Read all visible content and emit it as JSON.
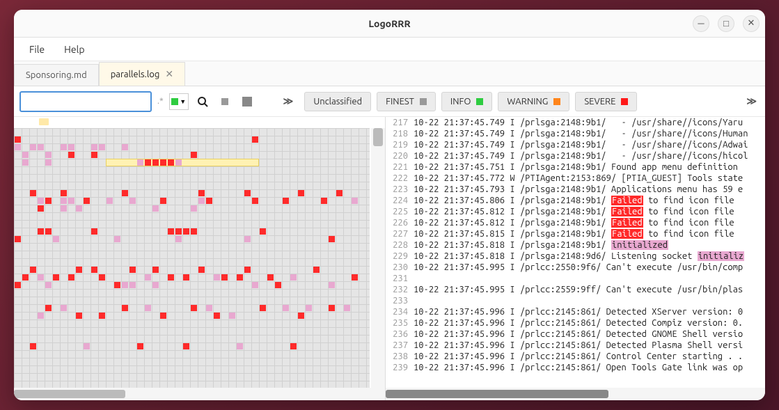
{
  "window": {
    "title": "LogoRRR"
  },
  "menu": {
    "file": "File",
    "help": "Help"
  },
  "tabs": [
    {
      "label": "Sponsoring.md",
      "active": false,
      "closable": false
    },
    {
      "label": "parallels.log",
      "active": true,
      "closable": true
    }
  ],
  "toolbar": {
    "search_value": "",
    "color_swatch": "#2ecc40"
  },
  "filters": [
    {
      "label": "Unclassified",
      "color": null
    },
    {
      "label": "FINEST",
      "color": "gray"
    },
    {
      "label": "INFO",
      "color": "green"
    },
    {
      "label": "WARNING",
      "color": "orange"
    },
    {
      "label": "SEVERE",
      "color": "red"
    }
  ],
  "log": [
    {
      "n": 217,
      "t": "10-22 21:37:45.749 I /prlsga:2148:9b1/   - /usr/share//icons/Yaru"
    },
    {
      "n": 218,
      "t": "10-22 21:37:45.749 I /prlsga:2148:9b1/   - /usr/share//icons/Human"
    },
    {
      "n": 219,
      "t": "10-22 21:37:45.749 I /prlsga:2148:9b1/   - /usr/share//icons/Adwai"
    },
    {
      "n": 220,
      "t": "10-22 21:37:45.749 I /prlsga:2148:9b1/   - /usr/share//icons/hicol"
    },
    {
      "n": 221,
      "t": "10-22 21:37:45.751 I /prlsga:2148:9b1/ Found app menu definition "
    },
    {
      "n": 222,
      "t": "10-22 21:37:45.772 W /PTIAgent:2153:869/ [PTIA_GUEST] Tools state"
    },
    {
      "n": 223,
      "t": "10-22 21:37:45.793 I /prlsga:2148:9b1/ Applications menu has 59 e"
    },
    {
      "n": 224,
      "pre": "10-22 21:37:45.806 I /prlsga:2148:9b1/ ",
      "hl": "Failed",
      "hlc": "red",
      "post": " to find icon file"
    },
    {
      "n": 225,
      "pre": "10-22 21:37:45.812 I /prlsga:2148:9b1/ ",
      "hl": "Failed",
      "hlc": "red",
      "post": " to find icon file"
    },
    {
      "n": 226,
      "pre": "10-22 21:37:45.812 I /prlsga:2148:9b1/ ",
      "hl": "Failed",
      "hlc": "red",
      "post": " to find icon file"
    },
    {
      "n": 227,
      "pre": "10-22 21:37:45.815 I /prlsga:2148:9b1/ ",
      "hl": "Failed",
      "hlc": "red",
      "post": " to find icon file"
    },
    {
      "n": 228,
      "pre": "10-22 21:37:45.818 I /prlsga:2148:9b1/ ",
      "hl": "initialized",
      "hlc": "pink",
      "post": ""
    },
    {
      "n": 229,
      "pre": "10-22 21:37:45.818 I /prlsga:2148:9d6/ Listening socket ",
      "hl": "initializ",
      "hlc": "pink",
      "post": ""
    },
    {
      "n": 230,
      "t": "10-22 21:37:45.995 I /prlcc:2550:9f6/ Can't execute /usr/bin/comp"
    },
    {
      "n": 231,
      "t": ""
    },
    {
      "n": 232,
      "t": "10-22 21:37:45.995 I /prlcc:2559:9ff/ Can't execute /usr/bin/plas"
    },
    {
      "n": 233,
      "t": ""
    },
    {
      "n": 234,
      "t": "10-22 21:37:45.996 I /prlcc:2145:861/ Detected XServer version: 0"
    },
    {
      "n": 235,
      "t": "10-22 21:37:45.996 I /prlcc:2145:861/ Detected Compiz version: 0."
    },
    {
      "n": 236,
      "t": "10-22 21:37:45.996 I /prlcc:2145:861/ Detected GNOME Shell versio"
    },
    {
      "n": 237,
      "t": "10-22 21:37:45.996 I /prlcc:2145:861/ Detected Plasma Shell versi"
    },
    {
      "n": 238,
      "t": "10-22 21:37:45.996 I /prlcc:2145:861/ Control Center starting . ."
    },
    {
      "n": 239,
      "t": "10-22 21:37:45.996 I /prlcc:2145:861/ Open Tools Gate link was op"
    }
  ],
  "heatmap": {
    "cell": 11,
    "highlight": {
      "row": 4,
      "col_start": 12,
      "col_end": 31
    },
    "cells": [
      {
        "r": 1,
        "c": 0,
        "col": "#ff2a2a"
      },
      {
        "r": 1,
        "c": 31,
        "col": "#ff2a2a"
      },
      {
        "r": 2,
        "c": 0,
        "col": "#e8a8d0"
      },
      {
        "r": 2,
        "c": 2,
        "col": "#e8a8d0"
      },
      {
        "r": 2,
        "c": 3,
        "col": "#e8a8d0"
      },
      {
        "r": 2,
        "c": 6,
        "col": "#e8a8d0"
      },
      {
        "r": 2,
        "c": 7,
        "col": "#e8a8d0"
      },
      {
        "r": 2,
        "c": 10,
        "col": "#e8a8d0"
      },
      {
        "r": 2,
        "c": 11,
        "col": "#e8a8d0"
      },
      {
        "r": 2,
        "c": 14,
        "col": "#e8a8d0"
      },
      {
        "r": 3,
        "c": 1,
        "col": "#e8a8d0"
      },
      {
        "r": 3,
        "c": 4,
        "col": "#e8a8d0"
      },
      {
        "r": 3,
        "c": 7,
        "col": "#ff2a2a"
      },
      {
        "r": 3,
        "c": 10,
        "col": "#ff2a2a"
      },
      {
        "r": 3,
        "c": 23,
        "col": "#ff2a2a"
      },
      {
        "r": 4,
        "c": 1,
        "col": "#e8a8d0"
      },
      {
        "r": 4,
        "c": 4,
        "col": "#e8a8d0"
      },
      {
        "r": 4,
        "c": 16,
        "col": "#e8a8d0"
      },
      {
        "r": 4,
        "c": 17,
        "col": "#ff2a2a"
      },
      {
        "r": 4,
        "c": 18,
        "col": "#ff2a2a"
      },
      {
        "r": 4,
        "c": 19,
        "col": "#ff2a2a"
      },
      {
        "r": 4,
        "c": 20,
        "col": "#ff2a2a"
      },
      {
        "r": 4,
        "c": 21,
        "col": "#e8a8d0"
      },
      {
        "r": 8,
        "c": 2,
        "col": "#ff2a2a"
      },
      {
        "r": 8,
        "c": 6,
        "col": "#ff2a2a"
      },
      {
        "r": 8,
        "c": 14,
        "col": "#ff2a2a"
      },
      {
        "r": 8,
        "c": 24,
        "col": "#ff2a2a"
      },
      {
        "r": 8,
        "c": 30,
        "col": "#ff2a2a"
      },
      {
        "r": 8,
        "c": 37,
        "col": "#ff2a2a"
      },
      {
        "r": 8,
        "c": 42,
        "col": "#ff2a2a"
      },
      {
        "r": 9,
        "c": 3,
        "col": "#e8a8d0"
      },
      {
        "r": 9,
        "c": 4,
        "col": "#ff2a2a"
      },
      {
        "r": 9,
        "c": 6,
        "col": "#e8a8d0"
      },
      {
        "r": 9,
        "c": 7,
        "col": "#e8a8d0"
      },
      {
        "r": 9,
        "c": 9,
        "col": "#ff2a2a"
      },
      {
        "r": 9,
        "c": 12,
        "col": "#e8a8d0"
      },
      {
        "r": 9,
        "c": 15,
        "col": "#e8a8d0"
      },
      {
        "r": 9,
        "c": 19,
        "col": "#ff2a2a"
      },
      {
        "r": 9,
        "c": 24,
        "col": "#e8a8d0"
      },
      {
        "r": 9,
        "c": 25,
        "col": "#ff2a2a"
      },
      {
        "r": 9,
        "c": 31,
        "col": "#ff2a2a"
      },
      {
        "r": 9,
        "c": 35,
        "col": "#ff2a2a"
      },
      {
        "r": 9,
        "c": 40,
        "col": "#ff2a2a"
      },
      {
        "r": 9,
        "c": 44,
        "col": "#e8a8d0"
      },
      {
        "r": 10,
        "c": 3,
        "col": "#ff2a2a"
      },
      {
        "r": 10,
        "c": 6,
        "col": "#e8a8d0"
      },
      {
        "r": 10,
        "c": 8,
        "col": "#e8a8d0"
      },
      {
        "r": 10,
        "c": 18,
        "col": "#e8a8d0"
      },
      {
        "r": 10,
        "c": 23,
        "col": "#e8a8d0"
      },
      {
        "r": 13,
        "c": 3,
        "col": "#ff2a2a"
      },
      {
        "r": 13,
        "c": 4,
        "col": "#ff2a2a"
      },
      {
        "r": 13,
        "c": 10,
        "col": "#ff2a2a"
      },
      {
        "r": 13,
        "c": 20,
        "col": "#ff2a2a"
      },
      {
        "r": 13,
        "c": 21,
        "col": "#ff2a2a"
      },
      {
        "r": 13,
        "c": 22,
        "col": "#ff2a2a"
      },
      {
        "r": 13,
        "c": 23,
        "col": "#ff2a2a"
      },
      {
        "r": 13,
        "c": 32,
        "col": "#ff2a2a"
      },
      {
        "r": 14,
        "c": 0,
        "col": "#ff2a2a"
      },
      {
        "r": 14,
        "c": 5,
        "col": "#e8a8d0"
      },
      {
        "r": 14,
        "c": 13,
        "col": "#e8a8d0"
      },
      {
        "r": 14,
        "c": 21,
        "col": "#e8a8d0"
      },
      {
        "r": 14,
        "c": 30,
        "col": "#e8a8d0"
      },
      {
        "r": 14,
        "c": 41,
        "col": "#ff2a2a"
      },
      {
        "r": 18,
        "c": 2,
        "col": "#ff2a2a"
      },
      {
        "r": 18,
        "c": 8,
        "col": "#ff2a2a"
      },
      {
        "r": 18,
        "c": 10,
        "col": "#ff2a2a"
      },
      {
        "r": 18,
        "c": 15,
        "col": "#ff2a2a"
      },
      {
        "r": 18,
        "c": 18,
        "col": "#ff2a2a"
      },
      {
        "r": 18,
        "c": 24,
        "col": "#ff2a2a"
      },
      {
        "r": 18,
        "c": 30,
        "col": "#ff2a2a"
      },
      {
        "r": 18,
        "c": 39,
        "col": "#ff2a2a"
      },
      {
        "r": 19,
        "c": 1,
        "col": "#ff2a2a"
      },
      {
        "r": 19,
        "c": 3,
        "col": "#e8a8d0"
      },
      {
        "r": 19,
        "c": 5,
        "col": "#ff2a2a"
      },
      {
        "r": 19,
        "c": 7,
        "col": "#ff2a2a"
      },
      {
        "r": 19,
        "c": 11,
        "col": "#ff2a2a"
      },
      {
        "r": 19,
        "c": 17,
        "col": "#e8a8d0"
      },
      {
        "r": 19,
        "c": 20,
        "col": "#ff2a2a"
      },
      {
        "r": 19,
        "c": 22,
        "col": "#ff2a2a"
      },
      {
        "r": 19,
        "c": 26,
        "col": "#e8a8d0"
      },
      {
        "r": 19,
        "c": 27,
        "col": "#ff2a2a"
      },
      {
        "r": 19,
        "c": 29,
        "col": "#ff2a2a"
      },
      {
        "r": 19,
        "c": 33,
        "col": "#ff2a2a"
      },
      {
        "r": 19,
        "c": 36,
        "col": "#e8a8d0"
      },
      {
        "r": 19,
        "c": 44,
        "col": "#ff2a2a"
      },
      {
        "r": 20,
        "c": 0,
        "col": "#ff2a2a"
      },
      {
        "r": 20,
        "c": 4,
        "col": "#e8a8d0"
      },
      {
        "r": 20,
        "c": 13,
        "col": "#ff2a2a"
      },
      {
        "r": 20,
        "c": 14,
        "col": "#e8a8d0"
      },
      {
        "r": 20,
        "c": 15,
        "col": "#e8a8d0"
      },
      {
        "r": 20,
        "c": 18,
        "col": "#e8a8d0"
      },
      {
        "r": 20,
        "c": 31,
        "col": "#e8a8d0"
      },
      {
        "r": 20,
        "c": 34,
        "col": "#ff2a2a"
      },
      {
        "r": 20,
        "c": 41,
        "col": "#e8a8d0"
      },
      {
        "r": 23,
        "c": 4,
        "col": "#ff2a2a"
      },
      {
        "r": 23,
        "c": 6,
        "col": "#e8a8d0"
      },
      {
        "r": 23,
        "c": 14,
        "col": "#ff2a2a"
      },
      {
        "r": 23,
        "c": 17,
        "col": "#e8a8d0"
      },
      {
        "r": 23,
        "c": 23,
        "col": "#ff2a2a"
      },
      {
        "r": 23,
        "c": 25,
        "col": "#e8a8d0"
      },
      {
        "r": 23,
        "c": 32,
        "col": "#ff2a2a"
      },
      {
        "r": 23,
        "c": 35,
        "col": "#e8a8d0"
      },
      {
        "r": 23,
        "c": 38,
        "col": "#e8a8d0"
      },
      {
        "r": 23,
        "c": 41,
        "col": "#ff2a2a"
      },
      {
        "r": 23,
        "c": 43,
        "col": "#e8a8d0"
      },
      {
        "r": 24,
        "c": 3,
        "col": "#e8a8d0"
      },
      {
        "r": 24,
        "c": 8,
        "col": "#ff2a2a"
      },
      {
        "r": 24,
        "c": 11,
        "col": "#ff2a2a"
      },
      {
        "r": 24,
        "c": 19,
        "col": "#ff2a2a"
      },
      {
        "r": 24,
        "c": 26,
        "col": "#ff2a2a"
      },
      {
        "r": 24,
        "c": 28,
        "col": "#e8a8d0"
      },
      {
        "r": 24,
        "c": 37,
        "col": "#ff2a2a"
      },
      {
        "r": 28,
        "c": 2,
        "col": "#ff2a2a"
      },
      {
        "r": 28,
        "c": 9,
        "col": "#e8a8d0"
      },
      {
        "r": 28,
        "c": 16,
        "col": "#ff2a2a"
      },
      {
        "r": 28,
        "c": 22,
        "col": "#ff2a2a"
      },
      {
        "r": 28,
        "c": 29,
        "col": "#e8a8d0"
      },
      {
        "r": 28,
        "c": 36,
        "col": "#ff2a2a"
      }
    ]
  }
}
